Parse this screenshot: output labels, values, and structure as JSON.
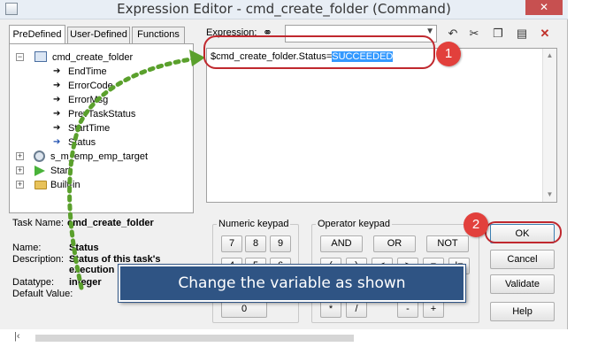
{
  "window": {
    "title": "Expression Editor - cmd_create_folder (Command)",
    "close_glyph": "✕"
  },
  "tabs": [
    "PreDefined",
    "User-Defined",
    "Functions"
  ],
  "tree": {
    "root": "cmd_create_folder",
    "children": [
      "EndTime",
      "ErrorCode",
      "ErrorMsg",
      "PrevTaskStatus",
      "StartTime",
      "Status"
    ],
    "others": [
      "s_m_emp_emp_target",
      "Start",
      "Built-in"
    ]
  },
  "task": {
    "label": "Task Name:",
    "value": "cmd_create_folder"
  },
  "info": {
    "name_label": "Name:",
    "name_value": "Status",
    "desc_label": "Description:",
    "desc_value": "Status of this task's execution",
    "type_label": "Datatype:",
    "type_value": "integer",
    "default_label": "Default Value:"
  },
  "expression": {
    "label": "Expression:",
    "text_prefix": "$cmd_create_folder.Status=",
    "text_selected": "SUCCEEDED"
  },
  "toolbar_icons": [
    "binoculars-icon",
    "undo-icon",
    "cut-icon",
    "copy-icon",
    "paste-icon",
    "delete-icon"
  ],
  "numeric_keypad": {
    "label": "Numeric keypad",
    "visible_keys": [
      "7",
      "8",
      "9",
      "4",
      "5",
      "6",
      "0"
    ]
  },
  "operator_keypad": {
    "label": "Operator keypad",
    "row1": [
      "AND",
      "OR",
      "NOT"
    ],
    "row2": [
      "(",
      ")",
      "<",
      ">",
      "=",
      "!="
    ],
    "row3": [
      "*",
      "/",
      "-",
      "+"
    ]
  },
  "actions": {
    "ok": "OK",
    "cancel": "Cancel",
    "validate": "Validate",
    "help": "Help"
  },
  "annotations": {
    "step1": "1",
    "step2": "2",
    "callout": "Change the variable as shown"
  },
  "colors": {
    "annotation_red": "#e2403c",
    "callout_blue": "#2f5484",
    "dots_green": "#5aa02c",
    "selection": "#3399ff"
  }
}
